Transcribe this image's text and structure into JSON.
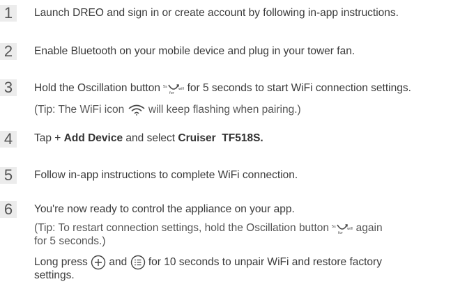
{
  "steps": [
    {
      "number": "1",
      "text": "Launch DREO and sign in or create account by following in-app instructions."
    },
    {
      "number": "2",
      "text": "Enable Bluetooth on your mobile device and plug in your tower fan."
    },
    {
      "number": "3",
      "text_before_icon": "Hold the Oscillation button",
      "text_after_icon": "for 5 seconds to start WiFi connection settings.",
      "tip_before_icon": "(Tip: The WiFi icon",
      "tip_after_icon": "will keep flashing when pairing.)"
    },
    {
      "number": "4",
      "text_prefix": "Tap +",
      "bold_action": "Add Device",
      "text_middle": "and select",
      "bold_model": "Cruiser  TF518S."
    },
    {
      "number": "5",
      "text": "Follow in-app instructions to complete WiFi connection."
    },
    {
      "number": "6",
      "text": "You're now ready to control the appliance on your app.",
      "tip_before_icon": "(Tip: To restart connection settings, hold the Oscillation button",
      "tip_after_icon": "again",
      "tip_line2": "for 5 seconds.)",
      "reset_before_plus": "Long press",
      "reset_between": "and",
      "reset_after_menu": "for 10 seconds to unpair WiFi and restore factory",
      "reset_line2": "settings."
    }
  ],
  "icons": {
    "oscillation": "oscillation-icon",
    "wifi": "wifi-icon",
    "plus": "plus-circle-icon",
    "menu": "menu-circle-icon"
  }
}
